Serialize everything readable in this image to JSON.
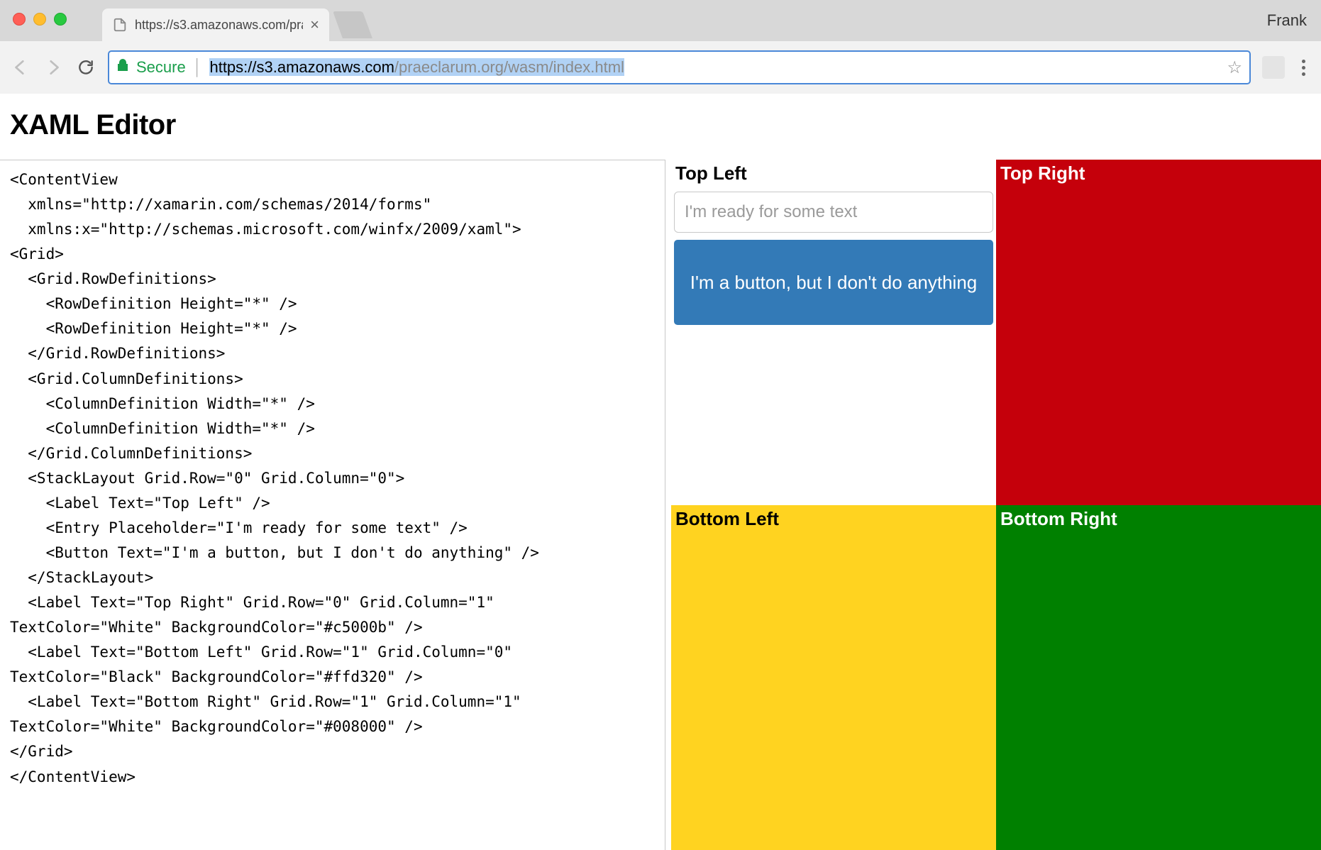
{
  "browser": {
    "profile_name": "Frank",
    "tab": {
      "title": "https://s3.amazonaws.com/pra"
    },
    "url": {
      "secure_label": "Secure",
      "scheme_host": "https://s3.amazonaws.com",
      "path": "/praeclarum.org/wasm/index.html"
    }
  },
  "page": {
    "title": "XAML Editor"
  },
  "editor": {
    "xaml": "<ContentView\n  xmlns=\"http://xamarin.com/schemas/2014/forms\"\n  xmlns:x=\"http://schemas.microsoft.com/winfx/2009/xaml\">\n<Grid>\n  <Grid.RowDefinitions>\n    <RowDefinition Height=\"*\" />\n    <RowDefinition Height=\"*\" />\n  </Grid.RowDefinitions>\n  <Grid.ColumnDefinitions>\n    <ColumnDefinition Width=\"*\" />\n    <ColumnDefinition Width=\"*\" />\n  </Grid.ColumnDefinitions>\n  <StackLayout Grid.Row=\"0\" Grid.Column=\"0\">\n    <Label Text=\"Top Left\" />\n    <Entry Placeholder=\"I'm ready for some text\" />\n    <Button Text=\"I'm a button, but I don't do anything\" />\n  </StackLayout>\n  <Label Text=\"Top Right\" Grid.Row=\"0\" Grid.Column=\"1\"\nTextColor=\"White\" BackgroundColor=\"#c5000b\" />\n  <Label Text=\"Bottom Left\" Grid.Row=\"1\" Grid.Column=\"0\"\nTextColor=\"Black\" BackgroundColor=\"#ffd320\" />\n  <Label Text=\"Bottom Right\" Grid.Row=\"1\" Grid.Column=\"1\"\nTextColor=\"White\" BackgroundColor=\"#008000\" />\n</Grid>\n</ContentView>"
  },
  "preview": {
    "top_left": {
      "label": "Top Left",
      "entry_placeholder": "I'm ready for some text",
      "button_text": "I'm a button, but I don't do anything"
    },
    "top_right": {
      "label": "Top Right",
      "bg": "#c5000b",
      "fg": "#ffffff"
    },
    "bottom_left": {
      "label": "Bottom Left",
      "bg": "#ffd320",
      "fg": "#000000"
    },
    "bottom_right": {
      "label": "Bottom Right",
      "bg": "#008000",
      "fg": "#ffffff"
    }
  }
}
